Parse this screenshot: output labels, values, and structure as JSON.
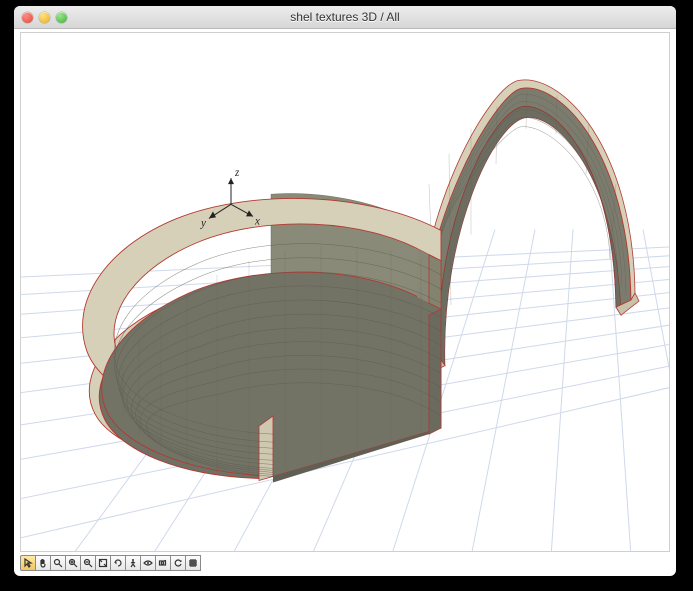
{
  "window": {
    "title": "shel textures 3D / All"
  },
  "axes": {
    "x": "x",
    "y": "y",
    "z": "z"
  },
  "toolbar": {
    "buttons": [
      {
        "name": "select-tool",
        "glyph": "cursor"
      },
      {
        "name": "pan-tool",
        "glyph": "hand"
      },
      {
        "name": "zoom-tool",
        "glyph": "zoom"
      },
      {
        "name": "zoom-in-tool",
        "glyph": "zoom-in"
      },
      {
        "name": "zoom-out-tool",
        "glyph": "zoom-out"
      },
      {
        "name": "zoom-extents-tool",
        "glyph": "fit"
      },
      {
        "name": "rotate-tool",
        "glyph": "rotate"
      },
      {
        "name": "walk-tool",
        "glyph": "walk"
      },
      {
        "name": "look-tool",
        "glyph": "look"
      },
      {
        "name": "camera-tool",
        "glyph": "camera"
      },
      {
        "name": "refresh-tool",
        "glyph": "refresh"
      },
      {
        "name": "grid-tool",
        "glyph": "grid"
      }
    ]
  }
}
